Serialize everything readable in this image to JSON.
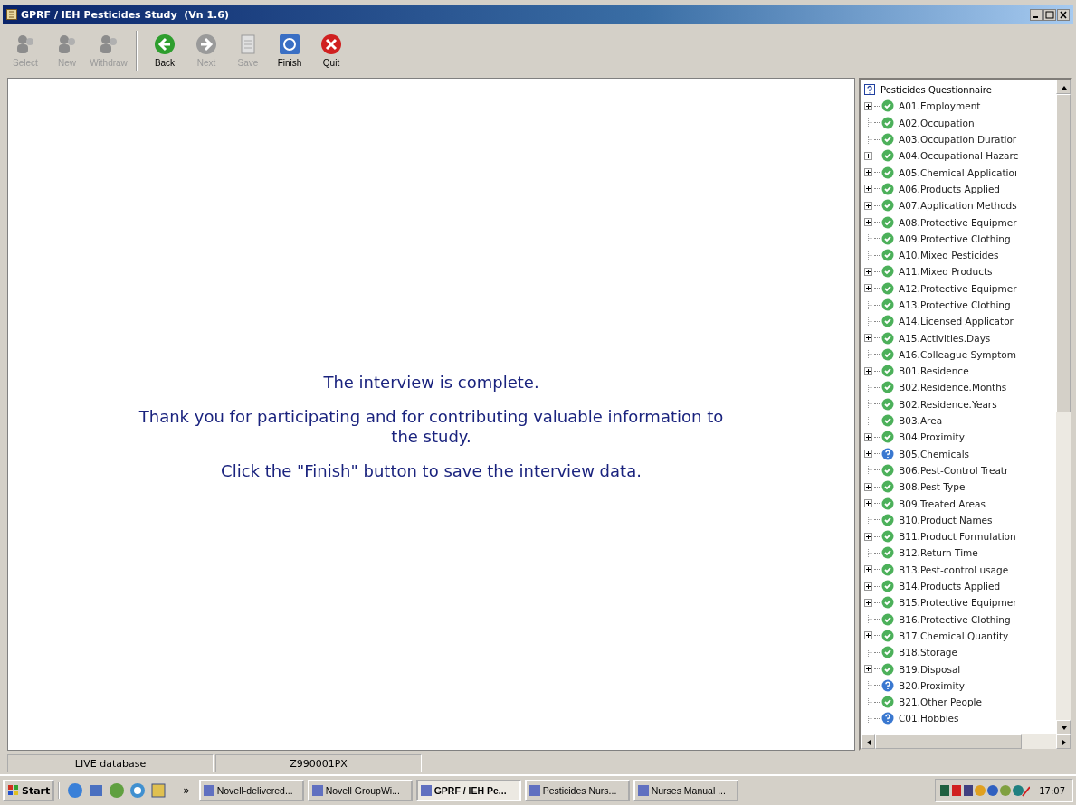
{
  "window": {
    "title": "GPRF / IEH Pesticides Study  (Vn 1.6)"
  },
  "toolbar": [
    {
      "label": "Select",
      "kind": "people",
      "disabled": true
    },
    {
      "label": "New",
      "kind": "people",
      "disabled": true
    },
    {
      "label": "Withdraw",
      "kind": "people",
      "disabled": true
    },
    {
      "label": "Back",
      "kind": "back",
      "disabled": false
    },
    {
      "label": "Next",
      "kind": "next",
      "disabled": true
    },
    {
      "label": "Save",
      "kind": "save",
      "disabled": true
    },
    {
      "label": "Finish",
      "kind": "finish",
      "disabled": false
    },
    {
      "label": "Quit",
      "kind": "quit",
      "disabled": false
    }
  ],
  "message": [
    "The interview is complete.",
    "Thank you for participating and for contributing valuable information to the study.",
    "Click the \"Finish\" button to save the interview data."
  ],
  "tree": {
    "root": "Pesticides Questionnaire",
    "items": [
      {
        "label": "A01.Employment",
        "expandable": true,
        "answered": true
      },
      {
        "label": "A02.Occupation",
        "expandable": false,
        "answered": true
      },
      {
        "label": "A03.Occupation Duratior",
        "expandable": false,
        "answered": true
      },
      {
        "label": "A04.Occupational Hazarc",
        "expandable": true,
        "answered": true
      },
      {
        "label": "A05.Chemical Applicatioı",
        "expandable": true,
        "answered": true
      },
      {
        "label": "A06.Products Applied",
        "expandable": true,
        "answered": true
      },
      {
        "label": "A07.Application Methods",
        "expandable": true,
        "answered": true
      },
      {
        "label": "A08.Protective Equipmer",
        "expandable": true,
        "answered": true
      },
      {
        "label": "A09.Protective Clothing",
        "expandable": false,
        "answered": true
      },
      {
        "label": "A10.Mixed Pesticides",
        "expandable": false,
        "answered": true
      },
      {
        "label": "A11.Mixed Products",
        "expandable": true,
        "answered": true
      },
      {
        "label": "A12.Protective Equipmer",
        "expandable": true,
        "answered": true
      },
      {
        "label": "A13.Protective Clothing",
        "expandable": false,
        "answered": true
      },
      {
        "label": "A14.Licensed Applicator",
        "expandable": false,
        "answered": true
      },
      {
        "label": "A15.Activities.Days",
        "expandable": true,
        "answered": true
      },
      {
        "label": "A16.Colleague Symptom",
        "expandable": false,
        "answered": true
      },
      {
        "label": "B01.Residence",
        "expandable": true,
        "answered": true
      },
      {
        "label": "B02.Residence.Months",
        "expandable": false,
        "answered": true
      },
      {
        "label": "B02.Residence.Years",
        "expandable": false,
        "answered": true
      },
      {
        "label": "B03.Area",
        "expandable": false,
        "answered": true
      },
      {
        "label": "B04.Proximity",
        "expandable": true,
        "answered": true
      },
      {
        "label": "B05.Chemicals",
        "expandable": true,
        "answered": false
      },
      {
        "label": "B06.Pest-Control Treatr",
        "expandable": false,
        "answered": true
      },
      {
        "label": "B08.Pest Type",
        "expandable": true,
        "answered": true
      },
      {
        "label": "B09.Treated Areas",
        "expandable": true,
        "answered": true
      },
      {
        "label": "B10.Product Names",
        "expandable": false,
        "answered": true
      },
      {
        "label": "B11.Product Formulation",
        "expandable": true,
        "answered": true
      },
      {
        "label": "B12.Return Time",
        "expandable": false,
        "answered": true
      },
      {
        "label": "B13.Pest-control usage",
        "expandable": true,
        "answered": true
      },
      {
        "label": "B14.Products Applied",
        "expandable": true,
        "answered": true
      },
      {
        "label": "B15.Protective Equipmer",
        "expandable": true,
        "answered": true
      },
      {
        "label": "B16.Protective Clothing",
        "expandable": false,
        "answered": true
      },
      {
        "label": "B17.Chemical Quantity",
        "expandable": true,
        "answered": true
      },
      {
        "label": "B18.Storage",
        "expandable": false,
        "answered": true
      },
      {
        "label": "B19.Disposal",
        "expandable": true,
        "answered": true
      },
      {
        "label": "B20.Proximity",
        "expandable": false,
        "answered": false
      },
      {
        "label": "B21.Other People",
        "expandable": false,
        "answered": true
      },
      {
        "label": "C01.Hobbies",
        "expandable": false,
        "answered": false
      }
    ]
  },
  "status_bar": [
    "LIVE database",
    "Z990001PX"
  ],
  "taskbar": {
    "start": "Start",
    "chevron": "»",
    "tasks": [
      {
        "label": "Novell-delivered...",
        "selected": false
      },
      {
        "label": "Novell GroupWi...",
        "selected": false
      },
      {
        "label": "GPRF / IEH Pe...",
        "selected": true
      },
      {
        "label": "Pesticides Nurs...",
        "selected": false
      },
      {
        "label": "Nurses Manual ...",
        "selected": false
      }
    ],
    "clock": "17:07"
  }
}
